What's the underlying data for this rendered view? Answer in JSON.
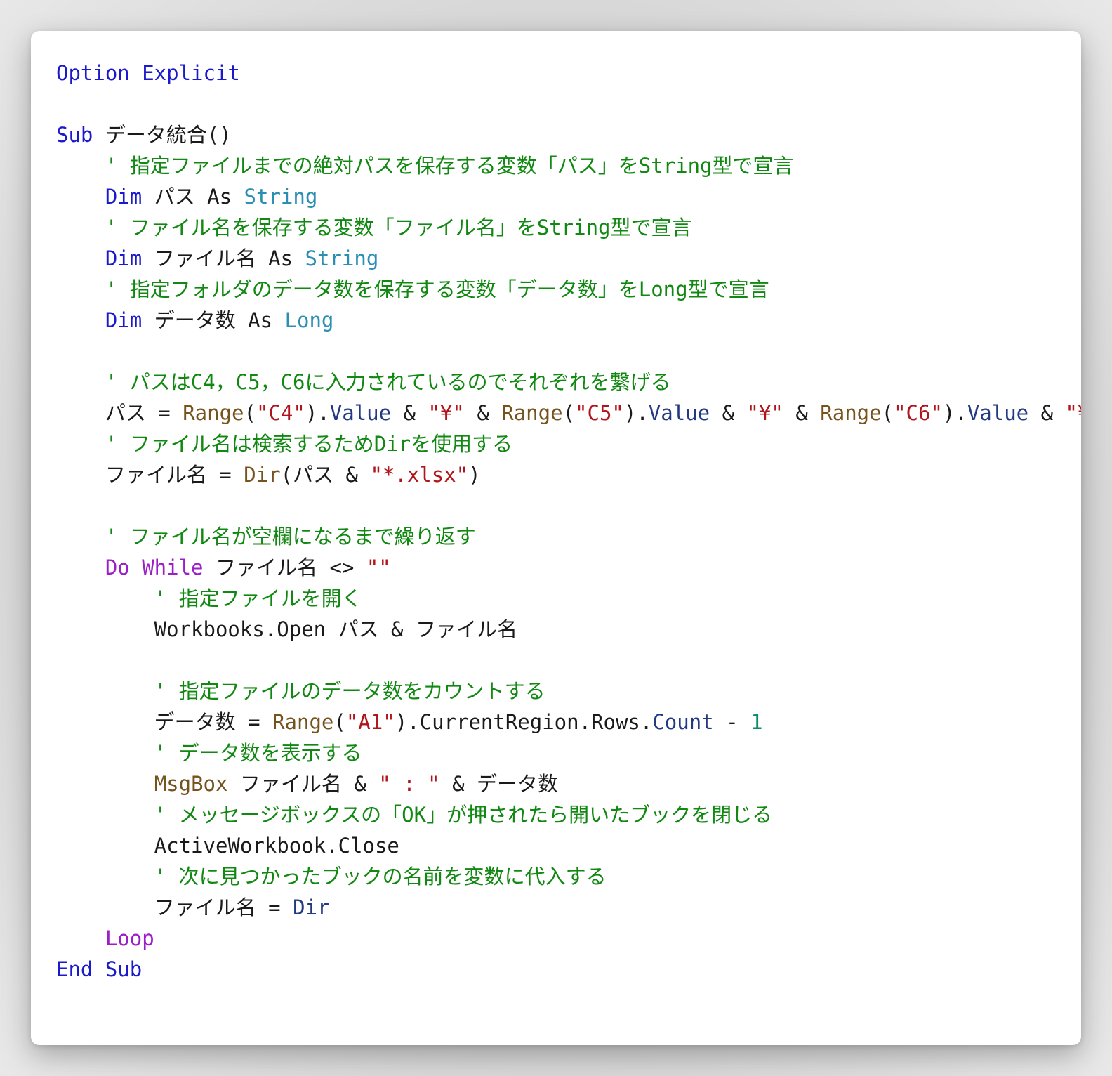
{
  "editor": {
    "language": "VBA",
    "token_colors": {
      "plain": "#1a1a1a",
      "keyword": "#1a1acc",
      "type": "#2b8fb3",
      "comment": "#118811",
      "string": "#b0151c",
      "function": "#76521d",
      "control": "#9b1ec9",
      "property": "#233a83",
      "number": "#0f8a6b"
    },
    "lines": [
      [
        {
          "t": "Option Explicit",
          "c": "keyword"
        }
      ],
      [],
      [
        {
          "t": "Sub",
          "c": "keyword"
        },
        {
          "t": " データ統合()",
          "c": "plain"
        }
      ],
      [
        {
          "t": "    ' 指定ファイルまでの絶対パスを保存する変数「パス」をString型で宣言",
          "c": "comment"
        }
      ],
      [
        {
          "t": "    ",
          "c": "plain"
        },
        {
          "t": "Dim",
          "c": "keyword"
        },
        {
          "t": " パス As ",
          "c": "plain"
        },
        {
          "t": "String",
          "c": "type"
        }
      ],
      [
        {
          "t": "    ' ファイル名を保存する変数「ファイル名」をString型で宣言",
          "c": "comment"
        }
      ],
      [
        {
          "t": "    ",
          "c": "plain"
        },
        {
          "t": "Dim",
          "c": "keyword"
        },
        {
          "t": " ファイル名 As ",
          "c": "plain"
        },
        {
          "t": "String",
          "c": "type"
        }
      ],
      [
        {
          "t": "    ' 指定フォルダのデータ数を保存する変数「データ数」をLong型で宣言",
          "c": "comment"
        }
      ],
      [
        {
          "t": "    ",
          "c": "plain"
        },
        {
          "t": "Dim",
          "c": "keyword"
        },
        {
          "t": " データ数 As ",
          "c": "plain"
        },
        {
          "t": "Long",
          "c": "type"
        }
      ],
      [],
      [
        {
          "t": "    ' パスはC4，C5，C6に入力されているのでそれぞれを繋げる",
          "c": "comment"
        }
      ],
      [
        {
          "t": "    パス = ",
          "c": "plain"
        },
        {
          "t": "Range",
          "c": "function"
        },
        {
          "t": "(",
          "c": "plain"
        },
        {
          "t": "\"C4\"",
          "c": "string"
        },
        {
          "t": ").",
          "c": "plain"
        },
        {
          "t": "Value",
          "c": "property"
        },
        {
          "t": " & ",
          "c": "plain"
        },
        {
          "t": "\"¥\"",
          "c": "string"
        },
        {
          "t": " & ",
          "c": "plain"
        },
        {
          "t": "Range",
          "c": "function"
        },
        {
          "t": "(",
          "c": "plain"
        },
        {
          "t": "\"C5\"",
          "c": "string"
        },
        {
          "t": ").",
          "c": "plain"
        },
        {
          "t": "Value",
          "c": "property"
        },
        {
          "t": " & ",
          "c": "plain"
        },
        {
          "t": "\"¥\"",
          "c": "string"
        },
        {
          "t": " & ",
          "c": "plain"
        },
        {
          "t": "Range",
          "c": "function"
        },
        {
          "t": "(",
          "c": "plain"
        },
        {
          "t": "\"C6\"",
          "c": "string"
        },
        {
          "t": ").",
          "c": "plain"
        },
        {
          "t": "Value",
          "c": "property"
        },
        {
          "t": " & ",
          "c": "plain"
        },
        {
          "t": "\"¥\"",
          "c": "string"
        }
      ],
      [
        {
          "t": "    ' ファイル名は検索するためDirを使用する",
          "c": "comment"
        }
      ],
      [
        {
          "t": "    ファイル名 = ",
          "c": "plain"
        },
        {
          "t": "Dir",
          "c": "function"
        },
        {
          "t": "(パス & ",
          "c": "plain"
        },
        {
          "t": "\"*.xlsx\"",
          "c": "string"
        },
        {
          "t": ")",
          "c": "plain"
        }
      ],
      [],
      [
        {
          "t": "    ' ファイル名が空欄になるまで繰り返す",
          "c": "comment"
        }
      ],
      [
        {
          "t": "    ",
          "c": "plain"
        },
        {
          "t": "Do While",
          "c": "control"
        },
        {
          "t": " ファイル名 <> ",
          "c": "plain"
        },
        {
          "t": "\"\"",
          "c": "string"
        }
      ],
      [
        {
          "t": "        ' 指定ファイルを開く",
          "c": "comment"
        }
      ],
      [
        {
          "t": "        Workbooks.Open パス & ファイル名",
          "c": "plain"
        }
      ],
      [],
      [
        {
          "t": "        ' 指定ファイルのデータ数をカウントする",
          "c": "comment"
        }
      ],
      [
        {
          "t": "        データ数 = ",
          "c": "plain"
        },
        {
          "t": "Range",
          "c": "function"
        },
        {
          "t": "(",
          "c": "plain"
        },
        {
          "t": "\"A1\"",
          "c": "string"
        },
        {
          "t": ").CurrentRegion.Rows.",
          "c": "plain"
        },
        {
          "t": "Count",
          "c": "property"
        },
        {
          "t": " - ",
          "c": "plain"
        },
        {
          "t": "1",
          "c": "number"
        }
      ],
      [
        {
          "t": "        ' データ数を表示する",
          "c": "comment"
        }
      ],
      [
        {
          "t": "        ",
          "c": "plain"
        },
        {
          "t": "MsgBox",
          "c": "function"
        },
        {
          "t": " ファイル名 & ",
          "c": "plain"
        },
        {
          "t": "\" : \"",
          "c": "string"
        },
        {
          "t": " & データ数",
          "c": "plain"
        }
      ],
      [
        {
          "t": "        ' メッセージボックスの「OK」が押されたら開いたブックを閉じる",
          "c": "comment"
        }
      ],
      [
        {
          "t": "        ActiveWorkbook.Close",
          "c": "plain"
        }
      ],
      [
        {
          "t": "        ' 次に見つかったブックの名前を変数に代入する",
          "c": "comment"
        }
      ],
      [
        {
          "t": "        ファイル名 = ",
          "c": "plain"
        },
        {
          "t": "Dir",
          "c": "property"
        }
      ],
      [
        {
          "t": "    ",
          "c": "plain"
        },
        {
          "t": "Loop",
          "c": "control"
        }
      ],
      [
        {
          "t": "End Sub",
          "c": "keyword"
        }
      ]
    ]
  }
}
